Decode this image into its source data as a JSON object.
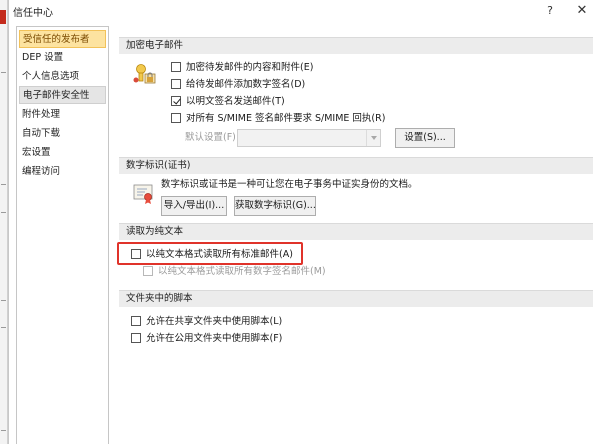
{
  "window": {
    "title": "信任中心",
    "help_label": "?",
    "close_label": "✕"
  },
  "sidebar": {
    "items": [
      {
        "label": "受信任的发布者",
        "state": "selected"
      },
      {
        "label": "DEP 设置",
        "state": ""
      },
      {
        "label": "个人信息选项",
        "state": ""
      },
      {
        "label": "电子邮件安全性",
        "state": "active"
      },
      {
        "label": "附件处理",
        "state": ""
      },
      {
        "label": "自动下载",
        "state": ""
      },
      {
        "label": "宏设置",
        "state": ""
      },
      {
        "label": "编程访问",
        "state": ""
      }
    ]
  },
  "encrypted_mail": {
    "header": "加密电子邮件",
    "options": [
      {
        "label": "加密待发邮件的内容和附件(E)",
        "checked": false
      },
      {
        "label": "给待发邮件添加数字签名(D)",
        "checked": false
      },
      {
        "label": "以明文签名发送邮件(T)",
        "checked": true
      },
      {
        "label": "对所有 S/MIME 签名邮件要求 S/MIME 回执(R)",
        "checked": false
      }
    ],
    "default_setting_label": "默认设置(F):",
    "default_setting_value": "",
    "settings_button": "设置(S)..."
  },
  "digital_id": {
    "header": "数字标识(证书)",
    "description": "数字标识或证书是一种可让您在电子事务中证实身份的文档。",
    "import_export_button": "导入/导出(I)...",
    "get_id_button": "获取数字标识(G)..."
  },
  "plain_text": {
    "header": "读取为纯文本",
    "options": [
      {
        "label": "以纯文本格式读取所有标准邮件(A)",
        "checked": false,
        "disabled": false
      },
      {
        "label": "以纯文本格式读取所有数字签名邮件(M)",
        "checked": false,
        "disabled": true
      }
    ]
  },
  "folder_scripts": {
    "header": "文件夹中的脚本",
    "options": [
      {
        "label": "允许在共享文件夹中使用脚本(L)",
        "checked": false
      },
      {
        "label": "允许在公用文件夹中使用脚本(F)",
        "checked": false
      }
    ]
  },
  "colors": {
    "selected_bg": "#fde3a0",
    "highlight_box": "#e0332a",
    "section_header_bg": "#ececec"
  }
}
